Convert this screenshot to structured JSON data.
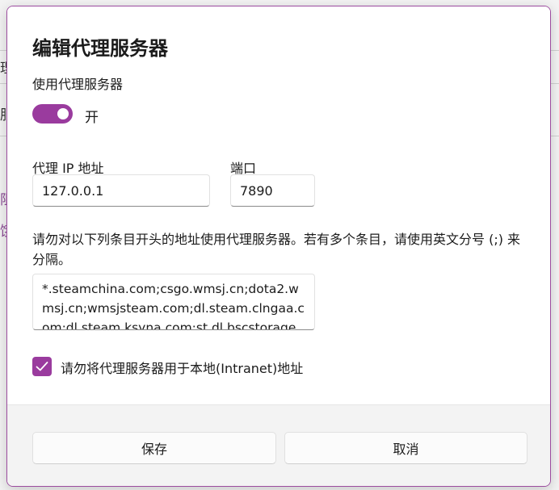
{
  "background": {
    "fragments": [
      "理",
      "服",
      "阻",
      "饿"
    ]
  },
  "dialog": {
    "title": "编辑代理服务器",
    "use_proxy_label": "使用代理服务器",
    "toggle": {
      "state": "on",
      "label": "开"
    },
    "proxy_ip_label": "代理 IP 地址",
    "proxy_ip_value": "127.0.0.1",
    "port_label": "端口",
    "port_value": "7890",
    "exceptions_label": "请勿对以下列条目开头的地址使用代理服务器。若有多个条目，请使用英文分号 (;) 来分隔。",
    "exceptions_value": "*.steamchina.com;csgo.wmsj.cn;dota2.wmsj.cn;wmsjsteam.com;dl.steam.clngaa.com;dl.steam.ksyna.com;st.dl.bscstorage.net",
    "bypass_local_checked": true,
    "bypass_local_label": "请勿将代理服务器用于本地(Intranet)地址",
    "save_button": "保存",
    "cancel_button": "取消"
  },
  "colors": {
    "accent": "#9a3b9e",
    "dialog_border": "#9c4c9f",
    "footer_bg": "#f3f3f3"
  }
}
